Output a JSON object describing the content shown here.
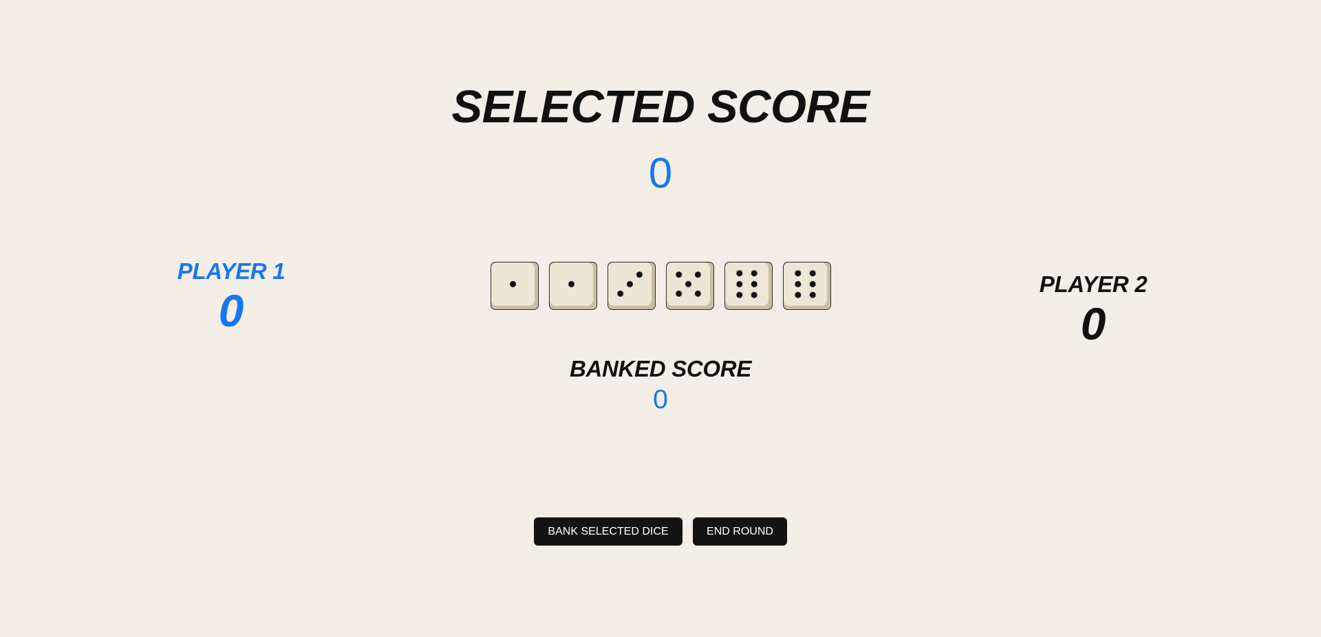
{
  "colors": {
    "background": "#f3eee8",
    "accent": "#1877f2",
    "text": "#111111",
    "button_bg": "#141414",
    "button_text": "#ffffff",
    "die_face": "#ece6d4",
    "die_shadow": "#c9bfa3",
    "pip": "#111111"
  },
  "selected": {
    "title": "SELECTED SCORE",
    "value": "0"
  },
  "players": [
    {
      "name": "PLAYER 1",
      "score": "0",
      "active": true
    },
    {
      "name": "PLAYER 2",
      "score": "0",
      "active": false
    }
  ],
  "dice": [
    1,
    1,
    3,
    5,
    6,
    6
  ],
  "banked": {
    "title": "BANKED SCORE",
    "value": "0"
  },
  "actions": {
    "bank_label": "BANK SELECTED DICE",
    "end_label": "END ROUND"
  }
}
